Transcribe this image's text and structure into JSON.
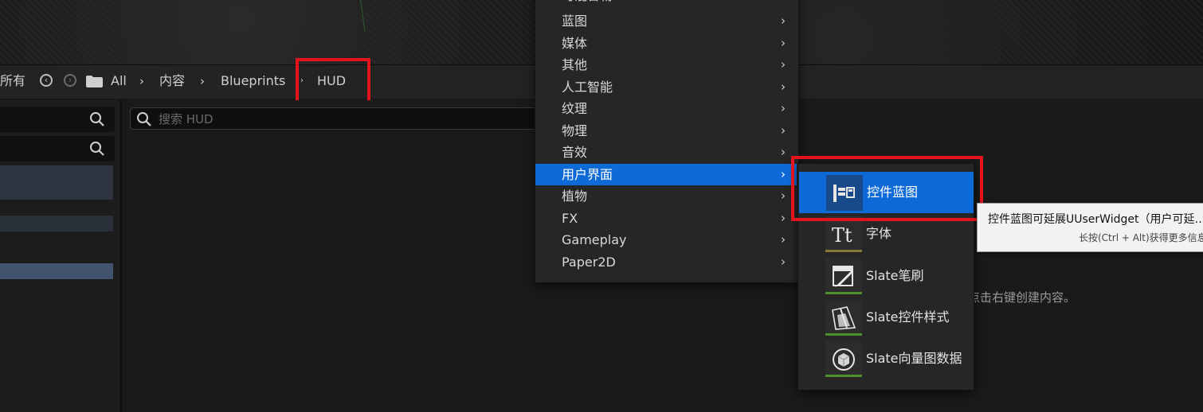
{
  "breadcrumb": {
    "left_label": "所有",
    "back_icon": "back-arrow-icon",
    "forward_icon": "forward-arrow-icon",
    "folder_icon": "folder-icon",
    "items": [
      "All",
      "内容",
      "Blueprints",
      "HUD"
    ]
  },
  "content": {
    "search_placeholder": "搜索 HUD",
    "search_value": "",
    "empty_hint": "点击右键创建内容。"
  },
  "menu": {
    "partial_top_label": "可混合物",
    "items": [
      {
        "label": "蓝图"
      },
      {
        "label": "媒体"
      },
      {
        "label": "其他"
      },
      {
        "label": "人工智能"
      },
      {
        "label": "纹理"
      },
      {
        "label": "物理"
      },
      {
        "label": "音效"
      },
      {
        "label": "用户界面",
        "active": true
      },
      {
        "label": "植物"
      },
      {
        "label": "FX"
      },
      {
        "label": "Gameplay"
      },
      {
        "label": "Paper2D"
      }
    ],
    "arrow_glyph": "›"
  },
  "submenu": {
    "items": [
      {
        "label": "控件蓝图",
        "icon": "widget-blueprint-icon",
        "active": true
      },
      {
        "label": "字体",
        "icon": "font-icon"
      },
      {
        "label": "Slate笔刷",
        "icon": "slate-brush-icon"
      },
      {
        "label": "Slate控件样式",
        "icon": "slate-widget-style-icon"
      },
      {
        "label": "Slate向量图数据",
        "icon": "slate-vector-data-icon"
      }
    ]
  },
  "tooltip": {
    "line1": "控件蓝图可延展UUserWidget（用户可延…",
    "line2": "长按(Ctrl + Alt)获得更多信息"
  },
  "colors": {
    "accent": "#0e6ad7",
    "highlight": "#e3141b",
    "font_stripe": "#8a7a3a",
    "slate_stripe": "#4f8f2f"
  }
}
